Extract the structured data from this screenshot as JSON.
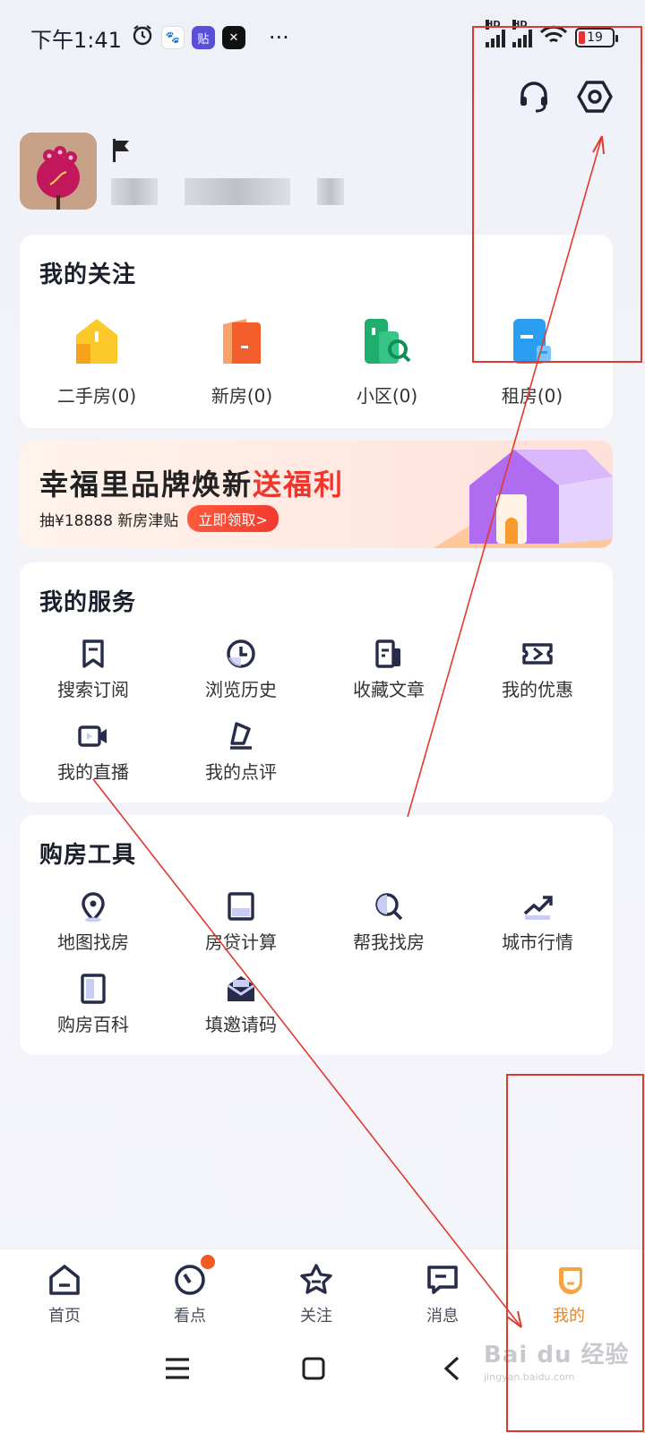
{
  "status": {
    "time": "下午1:41",
    "battery": "19",
    "signal_hd_1": "HD",
    "signal_hd_2": "HD",
    "app_icons": [
      "alarm-icon",
      "baidu-icon",
      "tieba-icon",
      "capcut-icon"
    ],
    "more": "···"
  },
  "header": {
    "icons": [
      "headset-icon",
      "settings-icon"
    ]
  },
  "follow": {
    "title": "我的关注",
    "items": [
      {
        "label": "二手房(0)",
        "icon": "second-hand-house-icon",
        "color": "#f9b81c"
      },
      {
        "label": "新房(0)",
        "icon": "new-house-icon",
        "color": "#f25e2c"
      },
      {
        "label": "小区(0)",
        "icon": "community-icon",
        "color": "#1fae6c"
      },
      {
        "label": "租房(0)",
        "icon": "rent-house-icon",
        "color": "#2b9ef2"
      }
    ]
  },
  "banner": {
    "title_main": "幸福里品牌焕新",
    "title_highlight": "送福利",
    "subtitle": "抽¥18888 新房津贴",
    "button": "立即领取>"
  },
  "services": {
    "title": "我的服务",
    "items": [
      {
        "label": "搜索订阅",
        "icon": "bookmark-icon"
      },
      {
        "label": "浏览历史",
        "icon": "clock-icon"
      },
      {
        "label": "收藏文章",
        "icon": "article-icon"
      },
      {
        "label": "我的优惠",
        "icon": "coupon-icon"
      },
      {
        "label": "我的直播",
        "icon": "video-icon"
      },
      {
        "label": "我的点评",
        "icon": "comment-icon"
      }
    ]
  },
  "tools": {
    "title": "购房工具",
    "items": [
      {
        "label": "地图找房",
        "icon": "map-pin-icon"
      },
      {
        "label": "房贷计算",
        "icon": "calculator-icon"
      },
      {
        "label": "帮我找房",
        "icon": "search-icon"
      },
      {
        "label": "城市行情",
        "icon": "trend-icon"
      },
      {
        "label": "购房百科",
        "icon": "book-icon"
      },
      {
        "label": "填邀请码",
        "icon": "envelope-icon"
      }
    ]
  },
  "nav": {
    "items": [
      {
        "label": "首页",
        "icon": "home-icon"
      },
      {
        "label": "看点",
        "icon": "discover-icon"
      },
      {
        "label": "关注",
        "icon": "star-icon"
      },
      {
        "label": "消息",
        "icon": "message-icon"
      },
      {
        "label": "我的",
        "icon": "me-icon",
        "active": true
      }
    ],
    "accent": "#e98424"
  },
  "watermark": {
    "text": "Bai du 经验",
    "sub": "jingyan.baidu.com"
  },
  "annotation_color": "#e03a2e"
}
